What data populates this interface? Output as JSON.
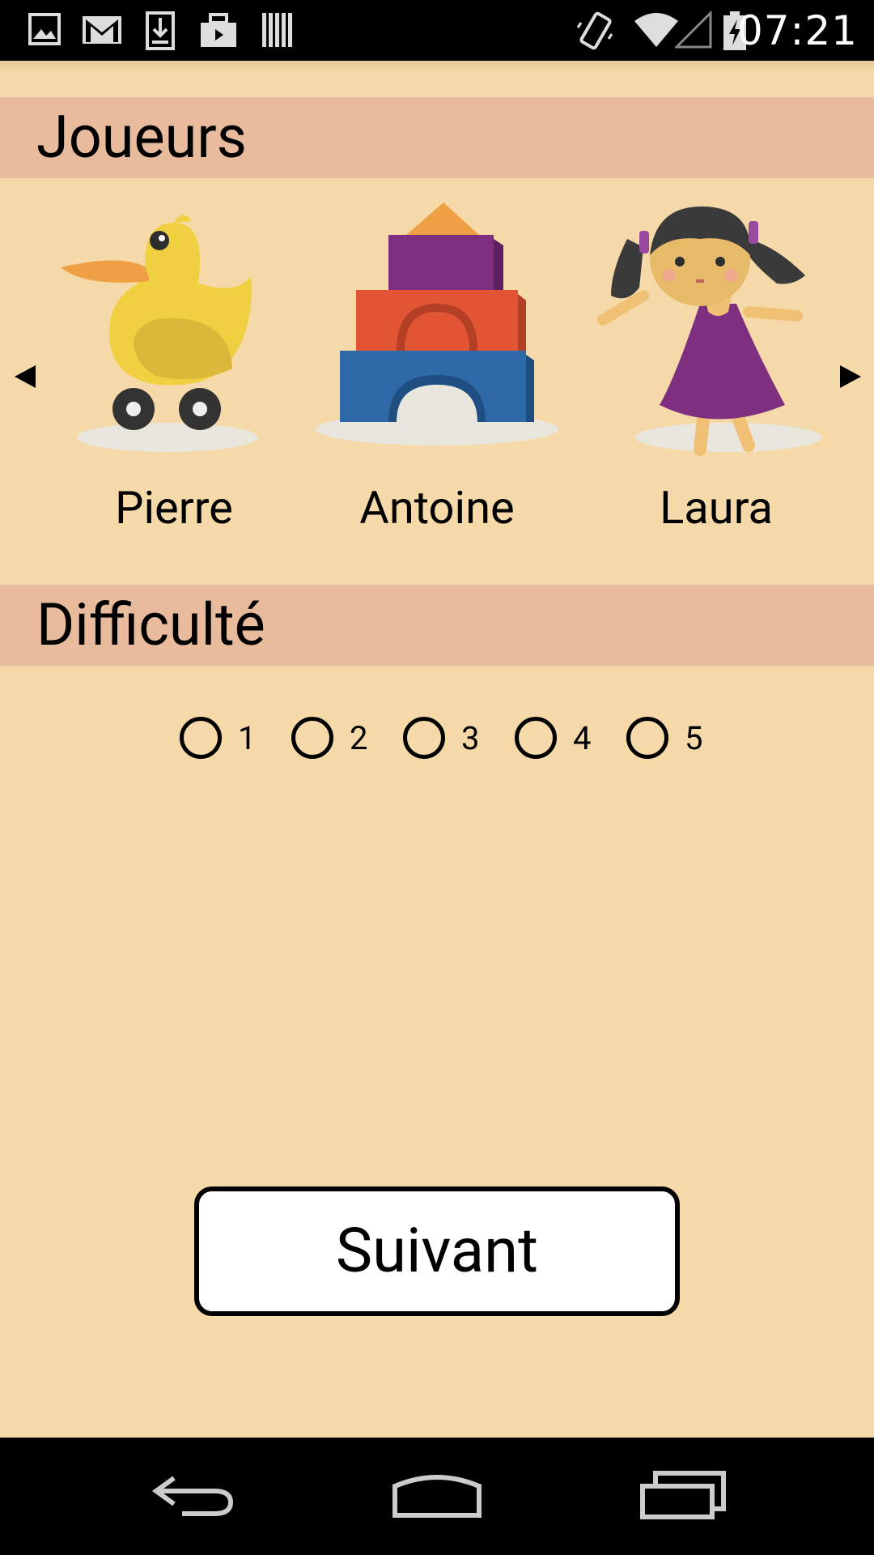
{
  "status_bar": {
    "time": "07:21",
    "left_icons": [
      "image-icon",
      "gmail-icon",
      "download-icon",
      "briefcase-icon",
      "barcode-icon"
    ],
    "right_icons": [
      "vibrate-icon",
      "wifi-icon",
      "cell-signal-icon",
      "battery-charging-icon"
    ]
  },
  "players_section": {
    "title": "Joueurs",
    "players": [
      {
        "name": "Pierre",
        "icon": "duck-toy-icon"
      },
      {
        "name": "Antoine",
        "icon": "building-blocks-icon"
      },
      {
        "name": "Laura",
        "icon": "doll-icon"
      }
    ]
  },
  "difficulty_section": {
    "title": "Difficulté",
    "options": [
      "1",
      "2",
      "3",
      "4",
      "5"
    ],
    "selected": null
  },
  "next_button": {
    "label": "Suivant"
  },
  "nav_bar": {
    "buttons": [
      "back-icon",
      "home-icon",
      "recents-icon"
    ]
  },
  "colors": {
    "background": "#f5d9a8",
    "header": "#e8bb9d",
    "status_bar": "#000000"
  }
}
